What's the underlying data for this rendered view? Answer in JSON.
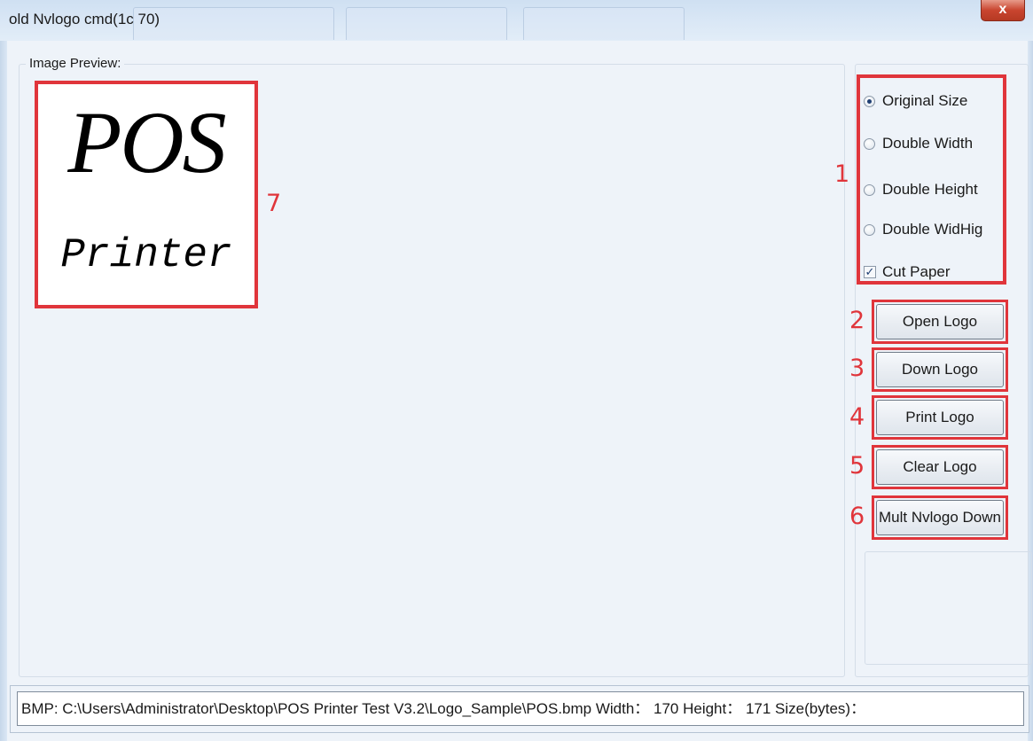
{
  "window": {
    "title": "old Nvlogo cmd(1c 70)",
    "close_label": "x"
  },
  "preview": {
    "label": "Image Preview:",
    "logo_line1": "POS",
    "logo_line2": "Printer"
  },
  "options": {
    "original_size": "Original Size",
    "double_width": "Double Width",
    "double_height": "Double Height",
    "double_widhig": "Double WidHig",
    "cut_paper": "Cut Paper",
    "selected": "Original Size",
    "cut_paper_checked": true
  },
  "buttons": {
    "open_logo": "Open Logo",
    "down_logo": "Down Logo",
    "print_logo": "Print Logo",
    "clear_logo": "Clear Logo",
    "mult_nvlogo_down": "Mult Nvlogo Down"
  },
  "annotations": {
    "n1": "1",
    "n2": "2",
    "n3": "3",
    "n4": "4",
    "n5": "5",
    "n6": "6",
    "n7": "7"
  },
  "status": {
    "text": "BMP: C:\\Users\\Administrator\\Desktop\\POS Printer Test V3.2\\Logo_Sample\\POS.bmp  Width： 170  Height： 171  Size(bytes)："
  },
  "colors": {
    "annotation_red": "#e0353b",
    "window_bg": "#eef3f9"
  }
}
